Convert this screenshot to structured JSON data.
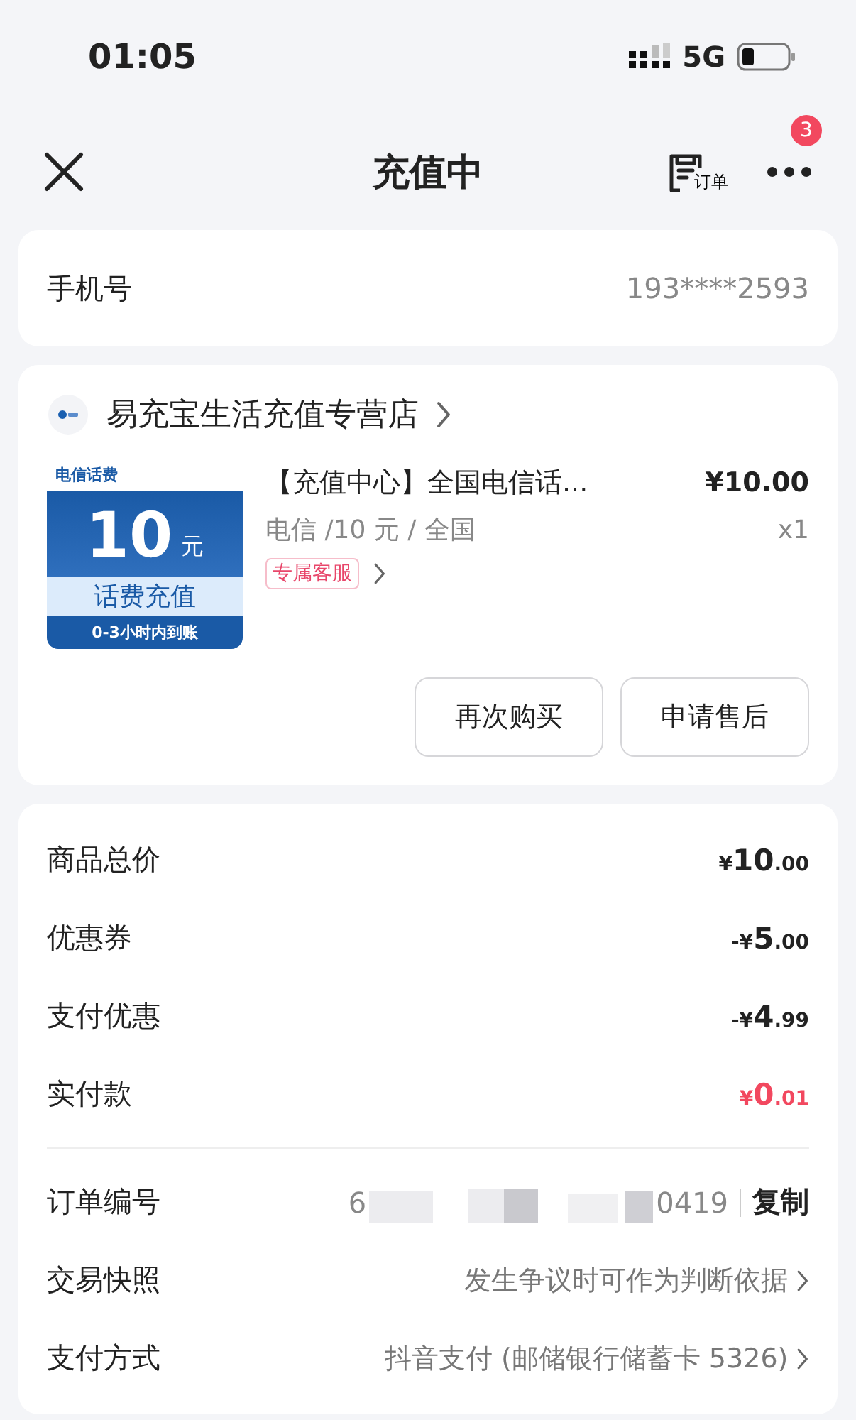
{
  "status_bar": {
    "time": "01:05",
    "network": "5G"
  },
  "nav": {
    "title": "充值中",
    "order_label": "订单",
    "badge": "3"
  },
  "phone": {
    "label": "手机号",
    "value": "193****2593"
  },
  "shop": {
    "name": "易充宝生活充值专营店",
    "product": {
      "image": {
        "top": "电信话费",
        "amount": "10",
        "unit": "元",
        "caption": "话费充值",
        "footer": "0-3小时内到账"
      },
      "title": "【充值中心】全国电信话...",
      "price": "¥10.00",
      "spec": "电信 /10 元 / 全国",
      "quantity": "x1",
      "tag": "专属客服"
    },
    "buttons": [
      "再次购买",
      "申请售后"
    ]
  },
  "prices": [
    {
      "label": "商品总价",
      "sign": "¥",
      "integer": "10",
      "fraction": ".00",
      "highlight": false
    },
    {
      "label": "优惠券",
      "sign": "-¥",
      "integer": "5",
      "fraction": ".00",
      "highlight": false
    },
    {
      "label": "支付优惠",
      "sign": "-¥",
      "integer": "4",
      "fraction": ".99",
      "highlight": false
    },
    {
      "label": "实付款",
      "sign": "¥",
      "integer": "0",
      "fraction": ".01",
      "highlight": true
    }
  ],
  "details": [
    {
      "label": "订单编号",
      "kind": "order",
      "value_start": "6",
      "value_end": "0419",
      "action": "复制"
    },
    {
      "label": "交易快照",
      "kind": "link",
      "value": "发生争议时可作为判断依据"
    },
    {
      "label": "支付方式",
      "kind": "link",
      "value": "抖音支付 (邮储银行储蓄卡 5326)"
    }
  ]
}
